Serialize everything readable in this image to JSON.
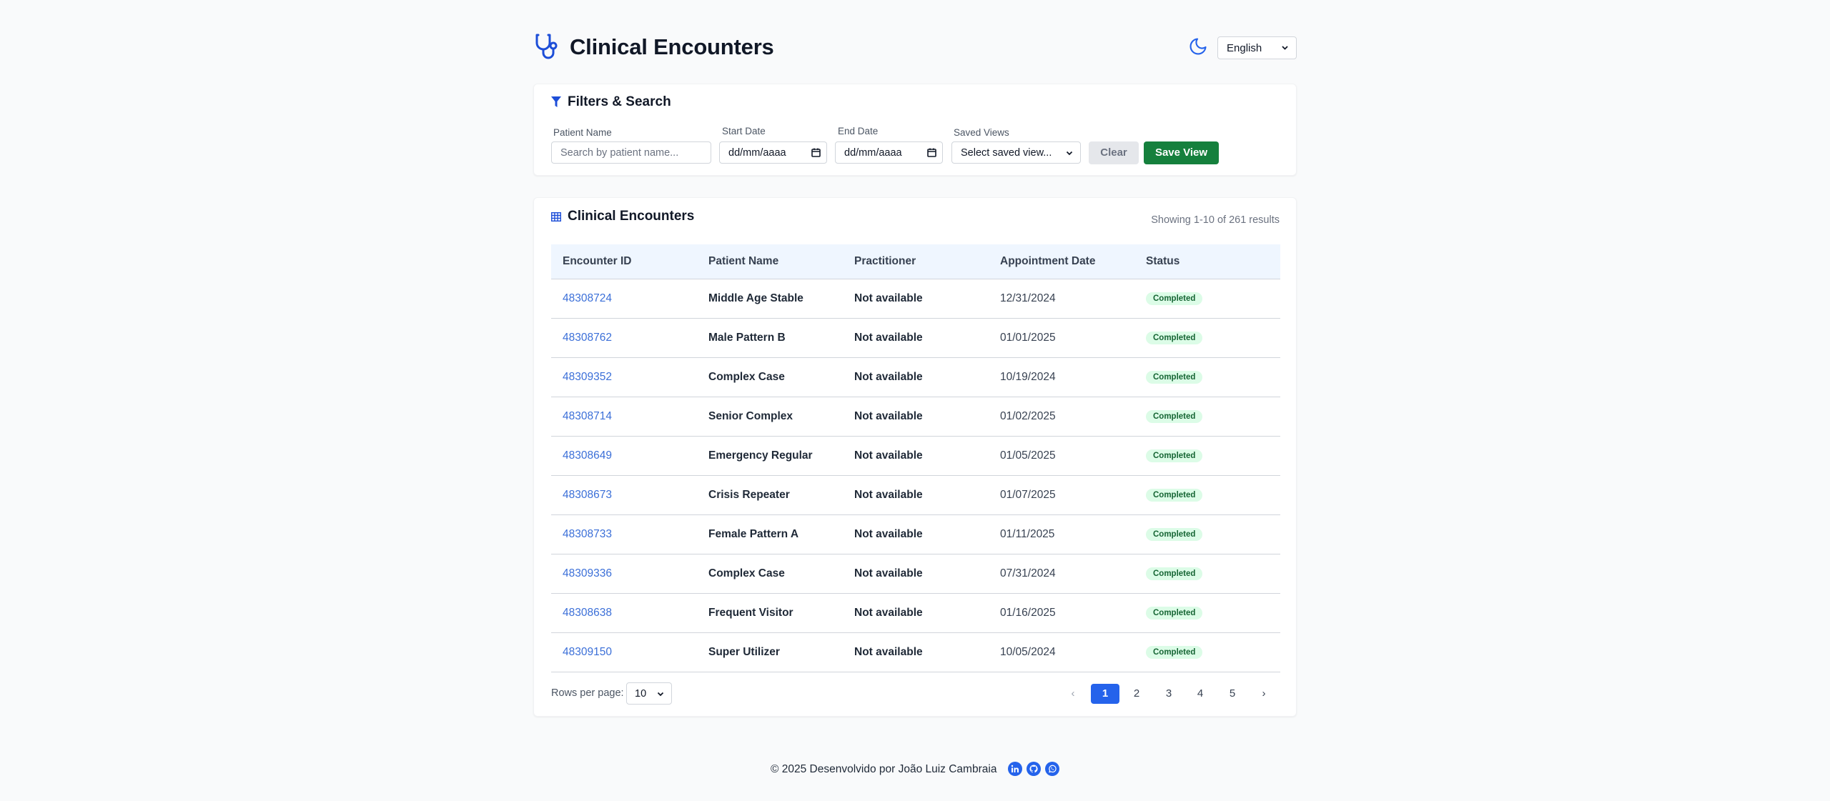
{
  "header": {
    "title": "Clinical Encounters",
    "language": "English",
    "logo_icon": "stethoscope-icon",
    "theme_icon": "moon-icon"
  },
  "filters": {
    "title": "Filters & Search",
    "patient_label": "Patient Name",
    "patient_placeholder": "Search by patient name...",
    "start_label": "Start Date",
    "start_value": "dd/mm/aaaa",
    "end_label": "End Date",
    "end_value": "dd/mm/aaaa",
    "views_label": "Saved Views",
    "views_value": "Select saved view...",
    "clear_label": "Clear",
    "save_label": "Save View"
  },
  "table": {
    "title": "Clinical Encounters",
    "showing": "Showing 1-10 of 261 results",
    "columns": [
      "Encounter ID",
      "Patient Name",
      "Practitioner",
      "Appointment Date",
      "Status"
    ],
    "rows": [
      [
        "48308724",
        "Middle Age Stable",
        "Not available",
        "12/31/2024",
        "Completed"
      ],
      [
        "48308762",
        "Male Pattern B",
        "Not available",
        "01/01/2025",
        "Completed"
      ],
      [
        "48309352",
        "Complex Case",
        "Not available",
        "10/19/2024",
        "Completed"
      ],
      [
        "48308714",
        "Senior Complex",
        "Not available",
        "01/02/2025",
        "Completed"
      ],
      [
        "48308649",
        "Emergency Regular",
        "Not available",
        "01/05/2025",
        "Completed"
      ],
      [
        "48308673",
        "Crisis Repeater",
        "Not available",
        "01/07/2025",
        "Completed"
      ],
      [
        "48308733",
        "Female Pattern A",
        "Not available",
        "01/11/2025",
        "Completed"
      ],
      [
        "48309336",
        "Complex Case",
        "Not available",
        "07/31/2024",
        "Completed"
      ],
      [
        "48308638",
        "Frequent Visitor",
        "Not available",
        "01/16/2025",
        "Completed"
      ],
      [
        "48309150",
        "Super Utilizer",
        "Not available",
        "10/05/2024",
        "Completed"
      ]
    ]
  },
  "pagination": {
    "rows_label": "Rows per page:",
    "rows_value": "10",
    "prev": "‹",
    "next": "›",
    "pages": [
      "1",
      "2",
      "3",
      "4",
      "5"
    ],
    "active_page": "1"
  },
  "footer": {
    "text": "© 2025 Desenvolvido por João Luiz Cambraia",
    "icons": [
      "linkedin-icon",
      "github-icon",
      "whatsapp-icon"
    ]
  },
  "colors": {
    "accent": "#2563eb",
    "save": "#15803d",
    "badge_bg": "#dcfce7",
    "badge_text": "#166534",
    "link": "#3b6fd8"
  }
}
